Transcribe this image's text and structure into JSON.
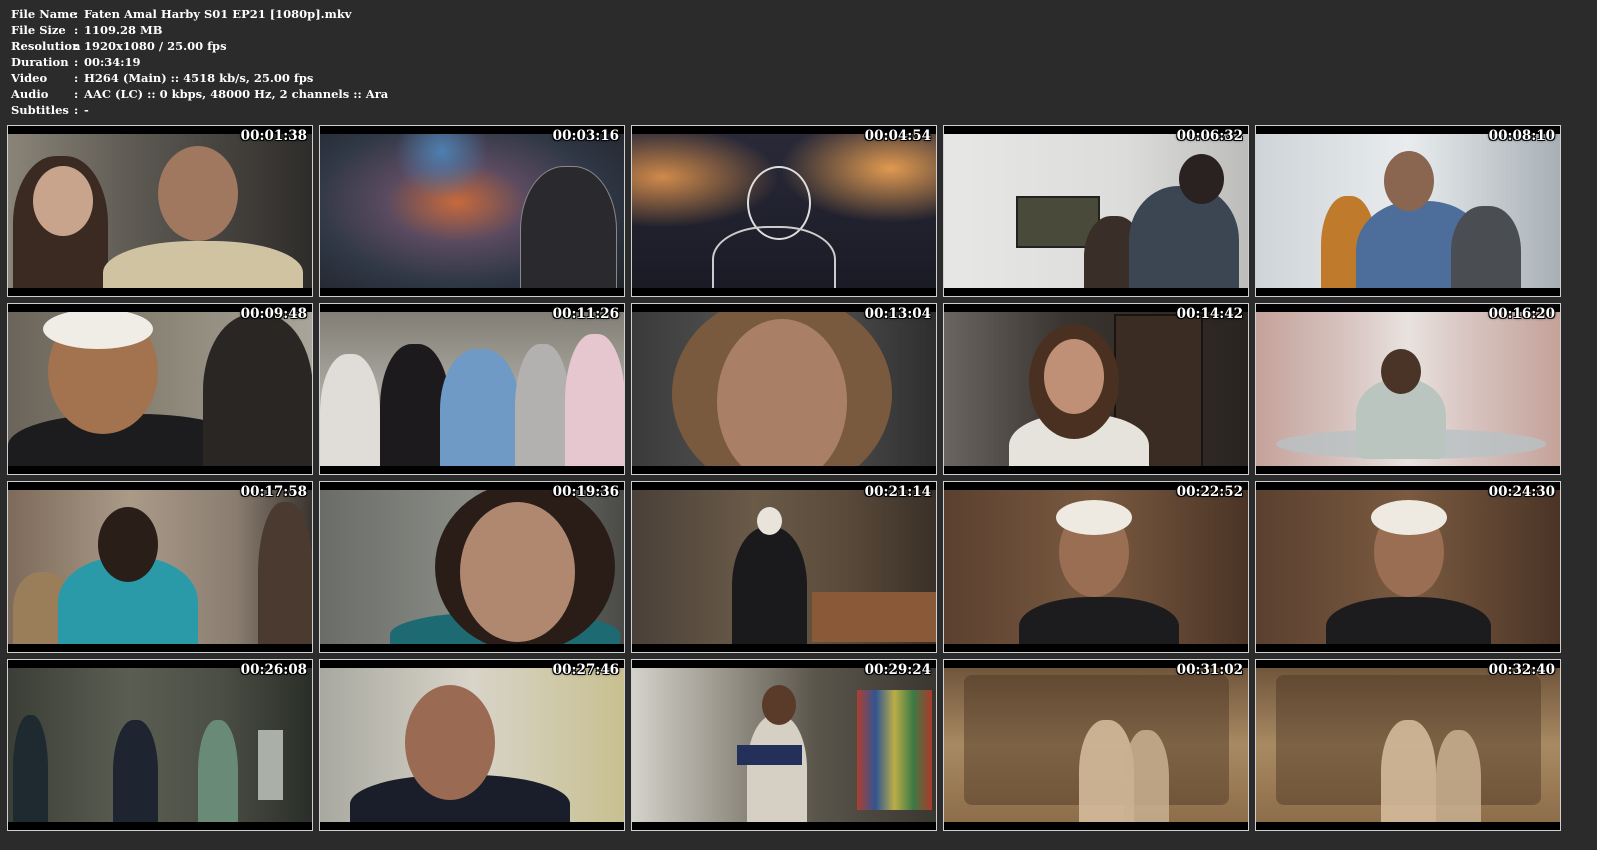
{
  "info": [
    {
      "label": "File Name",
      "sep": ":",
      "value": "Faten Amal Harby S01 EP21 [1080p].mkv"
    },
    {
      "label": "File Size",
      "sep": ":",
      "value": "1109.28 MB"
    },
    {
      "label": "Resolution",
      "sep": ":",
      "value": "1920x1080 / 25.00 fps"
    },
    {
      "label": "Duration",
      "sep": ":",
      "value": "00:34:19"
    },
    {
      "label": "Video",
      "sep": ":",
      "value": "H264 (Main) :: 4518 kb/s, 25.00 fps"
    },
    {
      "label": "Audio",
      "sep": ":",
      "value": "AAC (LC) :: 0 kbps, 48000 Hz, 2 channels :: Ara"
    },
    {
      "label": "Subtitles",
      "sep": ":",
      "value": "-"
    }
  ],
  "thumbnails": [
    {
      "time": "00:01:38"
    },
    {
      "time": "00:03:16"
    },
    {
      "time": "00:04:54"
    },
    {
      "time": "00:06:32"
    },
    {
      "time": "00:08:10"
    },
    {
      "time": "00:09:48"
    },
    {
      "time": "00:11:26"
    },
    {
      "time": "00:13:04"
    },
    {
      "time": "00:14:42"
    },
    {
      "time": "00:16:20"
    },
    {
      "time": "00:17:58"
    },
    {
      "time": "00:19:36"
    },
    {
      "time": "00:21:14"
    },
    {
      "time": "00:22:52"
    },
    {
      "time": "00:24:30"
    },
    {
      "time": "00:26:08"
    },
    {
      "time": "00:27:46"
    },
    {
      "time": "00:29:24"
    },
    {
      "time": "00:31:02"
    },
    {
      "time": "00:32:40"
    }
  ]
}
